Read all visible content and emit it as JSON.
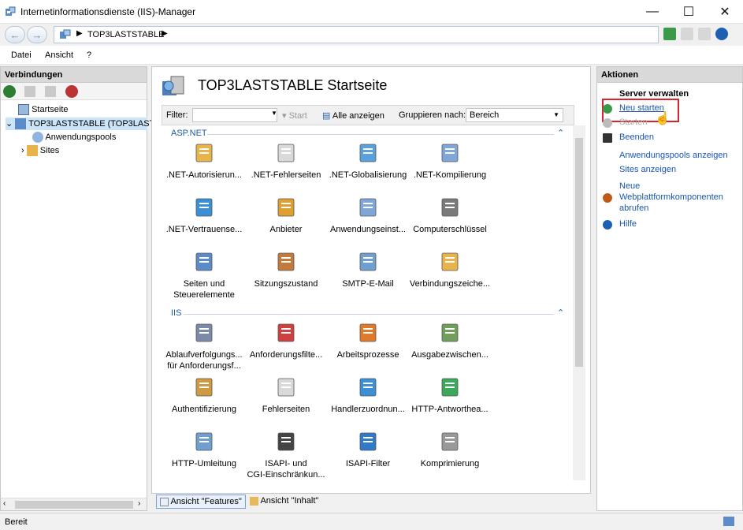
{
  "window": {
    "title": "Internetinformationsdienste (IIS)-Manager",
    "controls": {
      "minimize": "—",
      "maximize": "☐",
      "close": "✕"
    }
  },
  "address": {
    "breadcrumb": [
      "TOP3LASTSTABLE"
    ],
    "back": "←",
    "forward": "→"
  },
  "menu": [
    "Datei",
    "Ansicht",
    "?"
  ],
  "connections": {
    "header": "Verbindungen",
    "tree": [
      {
        "label": "Startseite",
        "level": 0
      },
      {
        "label": "TOP3LASTSTABLE (TOP3LAST",
        "level": 0,
        "expanded": true,
        "selected": true
      },
      {
        "label": "Anwendungspools",
        "level": 1
      },
      {
        "label": "Sites",
        "level": 1
      }
    ]
  },
  "main": {
    "title": "TOP3LASTSTABLE Startseite",
    "filter": {
      "label": "Filter:",
      "start": "Start",
      "show_all": "Alle anzeigen",
      "group_by_label": "Gruppieren nach:",
      "group_by_value": "Bereich"
    },
    "groups": [
      {
        "name": "ASP.NET",
        "items": [
          [
            ".NET-Autorisierun..."
          ],
          [
            ".NET-Fehlerseiten"
          ],
          [
            ".NET-Globalisierung"
          ],
          [
            ".NET-Kompilierung"
          ],
          [
            ".NET-Vertrauense..."
          ],
          [
            "Anbieter"
          ],
          [
            "Anwendungseinst..."
          ],
          [
            "Computerschlüssel"
          ],
          [
            "Seiten und",
            "Steuerelemente"
          ],
          [
            "Sitzungszustand"
          ],
          [
            "SMTP-E-Mail"
          ],
          [
            "Verbindungszeiche..."
          ]
        ]
      },
      {
        "name": "IIS",
        "items": [
          [
            "Ablaufverfolgungs...",
            "für Anforderungsf..."
          ],
          [
            "Anforderungsfilte..."
          ],
          [
            "Arbeitsprozesse"
          ],
          [
            "Ausgabezwischen..."
          ],
          [
            "Authentifizierung"
          ],
          [
            "Fehlerseiten"
          ],
          [
            "Handlerzuordnun..."
          ],
          [
            "HTTP-Antworthea..."
          ],
          [
            "HTTP-Umleitung"
          ],
          [
            "ISAPI- und",
            "CGI-Einschränkun..."
          ],
          [
            "ISAPI-Filter"
          ],
          [
            "Komprimierung"
          ]
        ]
      }
    ],
    "views": {
      "features": "Ansicht \"Features\"",
      "content": "Ansicht \"Inhalt\""
    }
  },
  "actions": {
    "header": "Aktionen",
    "section": "Server verwalten",
    "items": [
      {
        "label": "Neu starten",
        "enabled": true,
        "highlighted": true
      },
      {
        "label": "Starten",
        "enabled": false
      },
      {
        "label": "Beenden",
        "enabled": true
      },
      {
        "label": "Anwendungspools anzeigen",
        "enabled": true
      },
      {
        "label": "Sites anzeigen",
        "enabled": true
      },
      {
        "label": "Neue Webplattformkomponenten abrufen",
        "enabled": true
      },
      {
        "label": "Hilfe",
        "enabled": true
      }
    ],
    "webplatform_lines": [
      "Neue",
      "Webplattformkomponenten",
      "abrufen"
    ]
  },
  "status": {
    "text": "Bereit"
  },
  "colors": {
    "accent": "#1a56b0",
    "highlight": "#d9232d",
    "group": "#1e5aa8"
  }
}
